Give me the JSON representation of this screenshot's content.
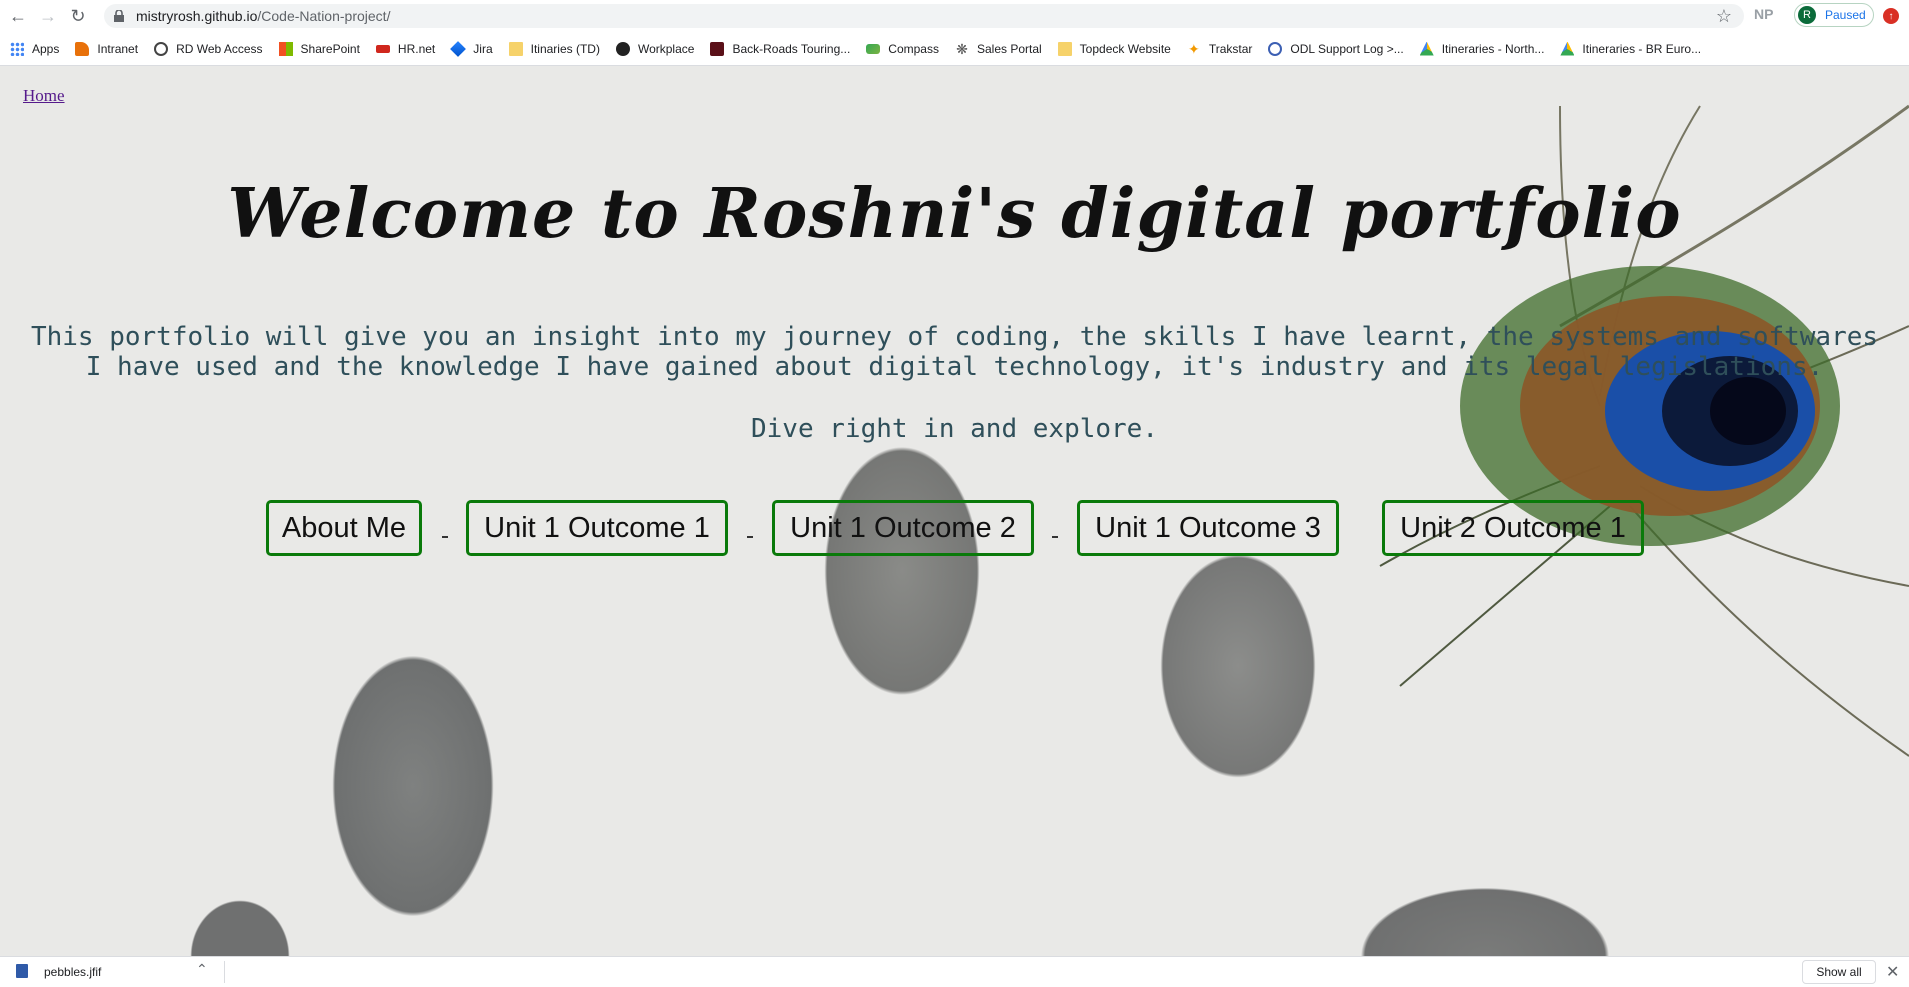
{
  "browser": {
    "url_host": "mistryrosh.github.io",
    "url_path": "/Code-Nation-project/",
    "extension_label": "NP",
    "profile": {
      "initial": "R",
      "status": "Paused"
    }
  },
  "bookmarks": [
    {
      "label": "Apps",
      "icon": "apps-grid-icon"
    },
    {
      "label": "Intranet",
      "icon": "intranet-icon"
    },
    {
      "label": "RD Web Access",
      "icon": "globe-icon"
    },
    {
      "label": "SharePoint",
      "icon": "windows-icon"
    },
    {
      "label": "HR.net",
      "icon": "adp-icon"
    },
    {
      "label": "Jira",
      "icon": "jira-icon"
    },
    {
      "label": "Itinaries (TD)",
      "icon": "folder-icon"
    },
    {
      "label": "Workplace",
      "icon": "workplace-icon"
    },
    {
      "label": "Back-Roads Touring...",
      "icon": "backroads-icon"
    },
    {
      "label": "Compass",
      "icon": "compass-icon"
    },
    {
      "label": "Sales Portal",
      "icon": "gear-icon"
    },
    {
      "label": "Topdeck Website",
      "icon": "folder-icon"
    },
    {
      "label": "Trakstar",
      "icon": "trakstar-icon"
    },
    {
      "label": "ODL Support Log >...",
      "icon": "odl-icon"
    },
    {
      "label": "Itineraries - North...",
      "icon": "drive-icon"
    },
    {
      "label": "Itineraries - BR Euro...",
      "icon": "drive-icon"
    }
  ],
  "page": {
    "home_link": "Home",
    "title": "Welcome to Roshni's digital portfolio",
    "intro": "This portfolio will give you an insight into my journey of coding, the skills I have learnt, the systems and softwares I have used and the knowledge I have gained about digital technology, it's industry and its legal legislations.",
    "dive": "Dive right in and explore.",
    "buttons": [
      "About Me",
      "Unit 1 Outcome 1",
      "Unit 1 Outcome 2",
      "Unit 1 Outcome 3",
      "Unit 2 Outcome 1"
    ]
  },
  "downloads": {
    "file_name": "pebbles.jfif",
    "show_all": "Show all"
  }
}
